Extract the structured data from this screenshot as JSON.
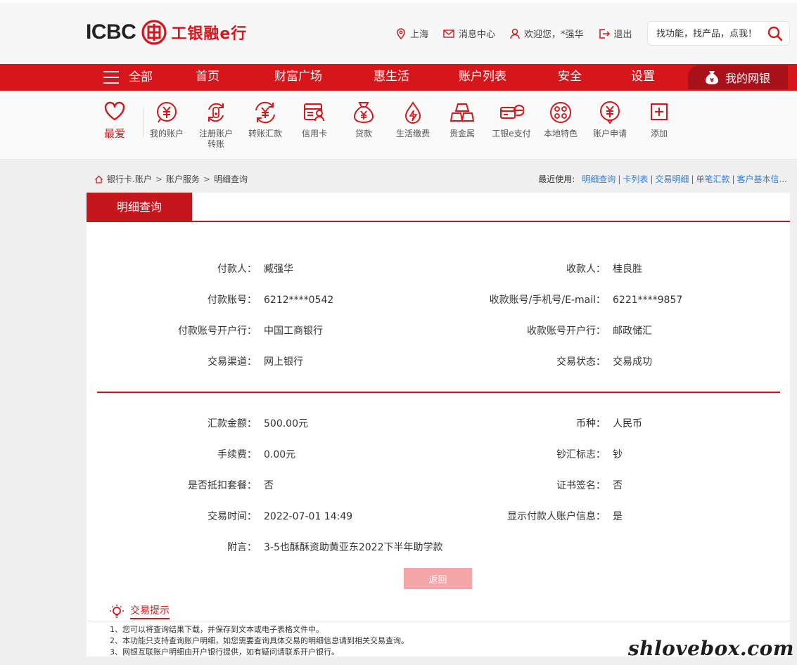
{
  "header": {
    "logo_en": "ICBC",
    "logo_cn": "工银融e行",
    "links": {
      "city": "上海",
      "messages": "消息中心",
      "welcome": "欢迎您，*强华",
      "logout": "退出"
    },
    "search_placeholder": "找功能，找产品，点我！"
  },
  "nav": {
    "all": "全部",
    "items": [
      "首页",
      "财富广场",
      "惠生活",
      "账户列表",
      "安全",
      "设置"
    ],
    "mybank": "我的网银"
  },
  "functions": {
    "favorite": "最爱",
    "items": [
      {
        "label": "我的账户",
        "icon": "yuan-circle-icon"
      },
      {
        "label": "注册账户转账",
        "icon": "transfer-cycle-icon"
      },
      {
        "label": "转账汇款",
        "icon": "yuan-arrows-icon"
      },
      {
        "label": "信用卡",
        "icon": "credit-card-icon"
      },
      {
        "label": "贷款",
        "icon": "money-bag-icon"
      },
      {
        "label": "生活缴费",
        "icon": "water-drop-icon"
      },
      {
        "label": "贵金属",
        "icon": "gold-bars-icon"
      },
      {
        "label": "工银e支付",
        "icon": "epay-icon"
      },
      {
        "label": "本地特色",
        "icon": "local-feature-icon"
      },
      {
        "label": "账户申请",
        "icon": "account-apply-icon"
      },
      {
        "label": "添加",
        "icon": "add-icon"
      }
    ]
  },
  "breadcrumb": {
    "items": [
      "银行卡.账户",
      "账户服务",
      "明细查询"
    ]
  },
  "recent": {
    "label": "最近使用:",
    "links": [
      "明细查询",
      "卡列表",
      "交易明细",
      "单笔汇款",
      "客户基本信..."
    ]
  },
  "panel": {
    "tab": "明细查询",
    "section1": [
      {
        "l_label": "付款人：",
        "l_value": "臧强华",
        "r_label": "收款人：",
        "r_value": "桂良胜"
      },
      {
        "l_label": "付款账号：",
        "l_value": "6212****0542",
        "r_label": "收款账号/手机号/E-mail：",
        "r_value": "6221****9857"
      },
      {
        "l_label": "付款账号开户行：",
        "l_value": "中国工商银行",
        "r_label": "收款账号开户行：",
        "r_value": "邮政储汇"
      },
      {
        "l_label": "交易渠道：",
        "l_value": "网上银行",
        "r_label": "交易状态：",
        "r_value": "交易成功"
      }
    ],
    "section2": [
      {
        "l_label": "汇款金额：",
        "l_value": "500.00元",
        "r_label": "币种：",
        "r_value": "人民币"
      },
      {
        "l_label": "手续费：",
        "l_value": "0.00元",
        "r_label": "钞汇标志：",
        "r_value": "钞"
      },
      {
        "l_label": "是否抵扣套餐：",
        "l_value": "否",
        "r_label": "证书签名：",
        "r_value": "否"
      },
      {
        "l_label": "交易时间：",
        "l_value": "2022-07-01 14:49",
        "r_label": "显示付款人账户信息：",
        "r_value": "是"
      }
    ],
    "memo_label": "附言：",
    "memo_value": "3-5也酥酥资助黄亚东2022下半年助学款",
    "back_button": "返回"
  },
  "tips": {
    "title": "交易提示",
    "lines": [
      "1、您可以将查询结果下载，并保存到文本或电子表格文件中。",
      "2、本功能只支持查询账户明细，如您需要查询具体交易的明细信息请到相关交易查询。",
      "3、网银互联账户明细由开户银行提供，如有疑问请联系开户银行。"
    ]
  },
  "watermark": "shlovebox.com",
  "colors": {
    "brand_red": "#d7161c",
    "dark_red": "#a8101a",
    "link_blue": "#2e7bd1",
    "button_pink": "#f4a5a8"
  }
}
